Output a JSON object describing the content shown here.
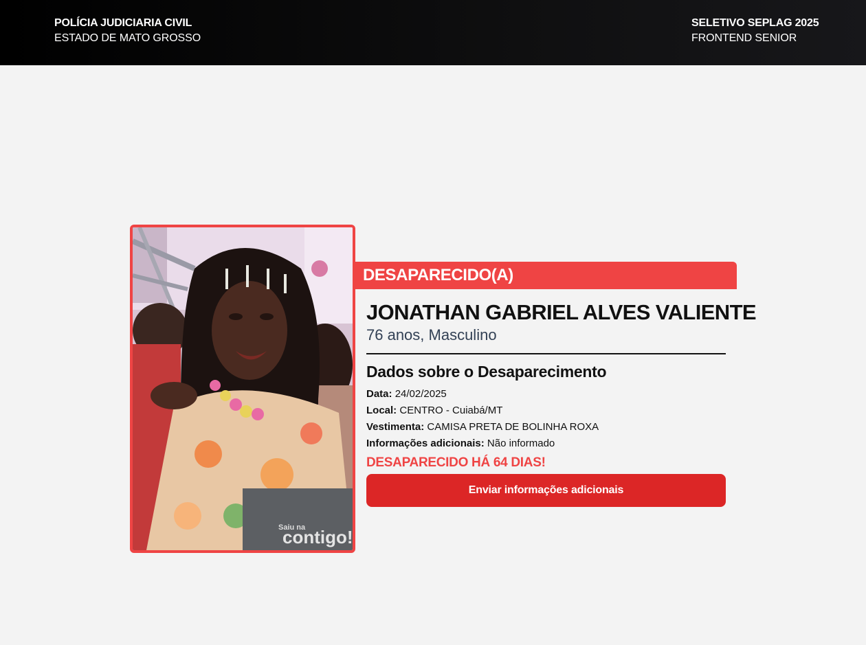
{
  "header": {
    "left_title": "POLÍCIA JUDICIARIA CIVIL",
    "left_subtitle": "ESTADO DE MATO GROSSO",
    "right_title": "SELETIVO SEPLAG 2025",
    "right_subtitle": "FRONTEND SENIOR"
  },
  "card": {
    "status": "DESAPARECIDO(A)",
    "name": "JONATHAN GABRIEL ALVES VALIENTE",
    "meta": "76 anos, Masculino",
    "section_title": "Dados sobre o Desaparecimento",
    "fields": {
      "date_label": "Data:",
      "date_value": "24/02/2025",
      "place_label": "Local:",
      "place_value": "CENTRO - Cuiabá/MT",
      "clothing_label": "Vestimenta:",
      "clothing_value": "CAMISA PRETA DE BOLINHA ROXA",
      "extra_label": "Informações adicionais:",
      "extra_value": "Não informado"
    },
    "days_missing": "DESAPARECIDO HÁ 64 DIAS!",
    "action_button": "Enviar informações adicionais",
    "photo_watermark_small": "Saiu na",
    "photo_watermark_large": "contigo!"
  },
  "colors": {
    "accent": "#ef4444",
    "button": "#dc2626",
    "header_bg": "#000000",
    "page_bg": "#f3f3f3"
  }
}
